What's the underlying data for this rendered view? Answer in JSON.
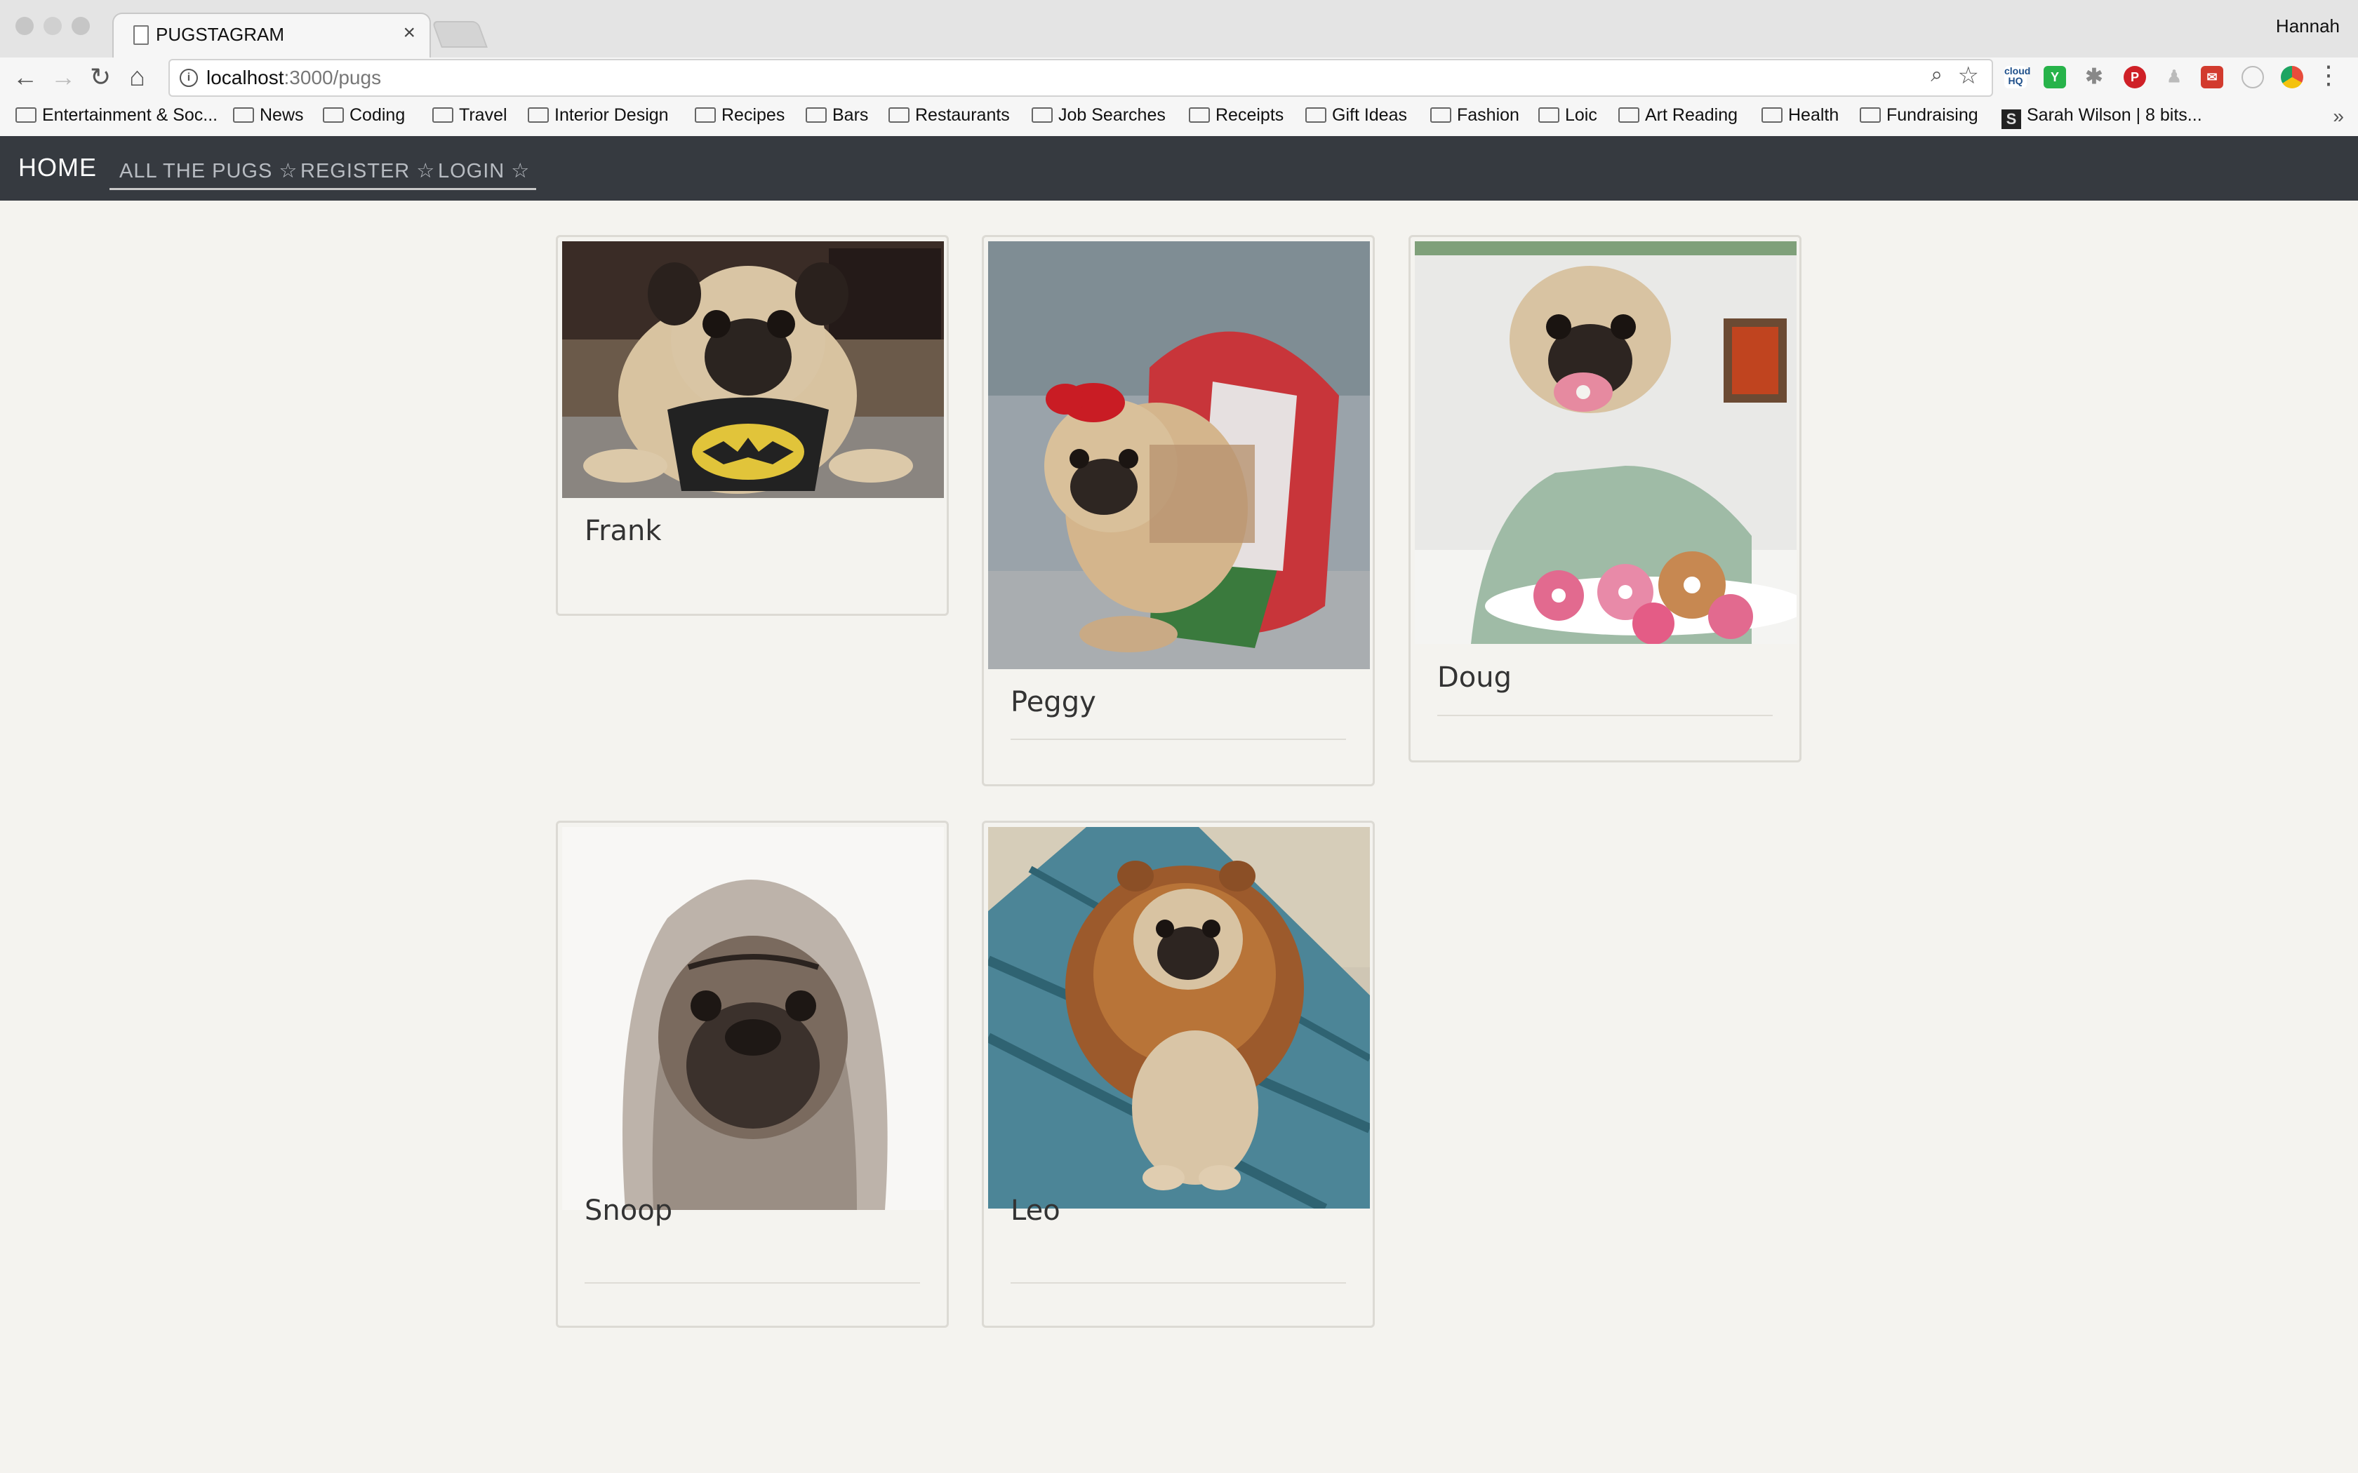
{
  "browser": {
    "tab_title": "PUGSTAGRAM",
    "tab_close": "×",
    "profile": "Hannah",
    "url_host": "localhost",
    "url_path": ":3000/pugs",
    "menu": "⋮",
    "more": "»"
  },
  "bookmarks": [
    "Entertainment & Soc...",
    "News",
    "Coding",
    "Travel",
    "Interior Design",
    "Recipes",
    "Bars",
    "Restaurants",
    "Job Searches",
    "Receipts",
    "Gift Ideas",
    "Fashion",
    "Loic",
    "Art Reading",
    "Health",
    "Fundraising",
    "Sarah Wilson | 8 bits..."
  ],
  "navbar": {
    "brand": "HOME",
    "links": [
      "ALL THE PUGS ☆",
      "REGISTER ☆",
      "LOGIN ☆"
    ]
  },
  "pugs": [
    {
      "name": "Frank",
      "photo": "pug-batman-bib-photo"
    },
    {
      "name": "Peggy",
      "photo": "pug-tutu-photo"
    },
    {
      "name": "Doug",
      "photo": "pug-donuts-photo"
    },
    {
      "name": "Snoop",
      "photo": "pug-hoodie-photo"
    },
    {
      "name": "Leo",
      "photo": "pug-lion-mane-photo"
    }
  ]
}
